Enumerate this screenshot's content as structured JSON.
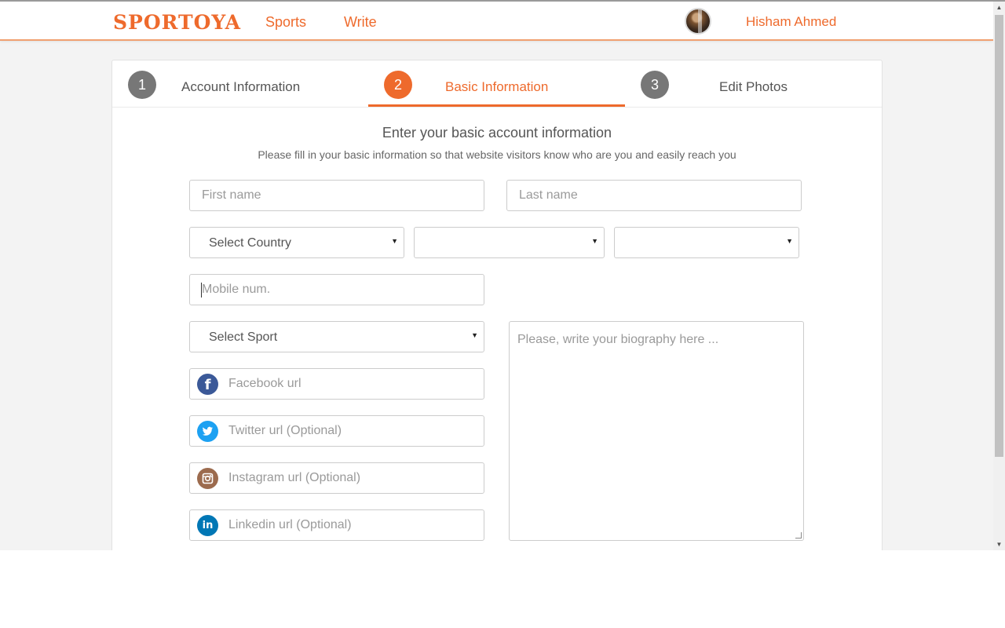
{
  "header": {
    "logo": "SPORTOYA",
    "nav": [
      {
        "label": "Sports"
      },
      {
        "label": "Write"
      }
    ],
    "user_name": "Hisham Ahmed"
  },
  "steps": [
    {
      "number": "1",
      "label": "Account Information",
      "active": false
    },
    {
      "number": "2",
      "label": "Basic Information",
      "active": true
    },
    {
      "number": "3",
      "label": "Edit Photos",
      "active": false
    }
  ],
  "form": {
    "title": "Enter your basic account information",
    "subtitle": "Please fill in your basic information so that website visitors know who are you and easily reach you",
    "first_name_placeholder": "First name",
    "last_name_placeholder": "Last name",
    "country_select": "Select Country",
    "state_select": "",
    "city_select": "",
    "mobile_placeholder": "Mobile num.",
    "sport_select": "Select Sport",
    "facebook_placeholder": "Facebook url",
    "twitter_placeholder": "Twitter url (Optional)",
    "instagram_placeholder": "Instagram url (Optional)",
    "linkedin_placeholder": "Linkedin url (Optional)",
    "bio_placeholder": "Please, write your biography here ..."
  },
  "icons": {
    "facebook": "facebook-icon",
    "twitter": "twitter-icon",
    "instagram": "instagram-icon",
    "linkedin": "linkedin-icon",
    "select_caret": "caret-down-icon"
  },
  "colors": {
    "accent": "#ee6a2c",
    "step_inactive": "#777777",
    "facebook": "#3b5998",
    "twitter": "#1da1f2",
    "instagram": "#9c6b4e",
    "linkedin": "#0077b5"
  }
}
